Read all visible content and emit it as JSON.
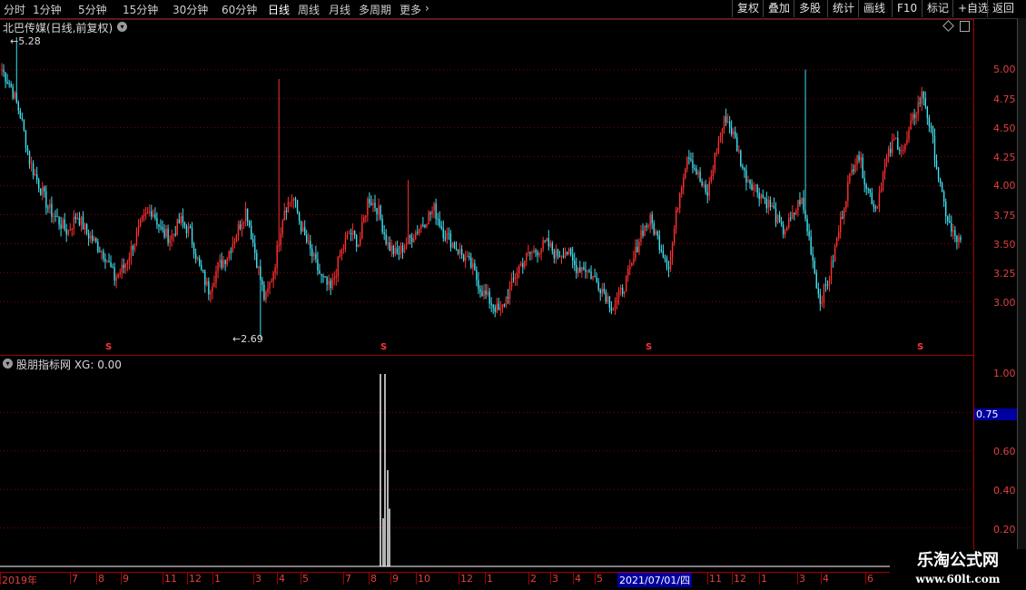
{
  "toolbar": {
    "timeframes": [
      "分时",
      "1分钟",
      "5分钟",
      "15分钟",
      "30分钟",
      "60分钟",
      "日线",
      "周线",
      "月线",
      "多周期",
      "更多"
    ],
    "active": "日线",
    "right_buttons": [
      "复权",
      "叠加",
      "多股",
      "统计",
      "画线",
      "F10",
      "标记",
      "+自选",
      "返回"
    ]
  },
  "main": {
    "title": "北巴传媒(日线,前复权)",
    "high_label": "5.28",
    "low_label": "2.69",
    "price_ticks": [
      "5.00",
      "4.75",
      "4.50",
      "4.25",
      "4.00",
      "3.75",
      "3.50",
      "3.25",
      "3.00"
    ],
    "signal_mark": "S"
  },
  "indicator": {
    "title": "股朋指标网 XG: 0.00",
    "ticks": [
      "1.00",
      "0.60",
      "0.40",
      "0.20"
    ],
    "highlight": "0.75"
  },
  "date_axis": {
    "labels": [
      "2019年",
      "7",
      "8",
      "9",
      "11",
      "12",
      "1",
      "3",
      "4",
      "5",
      "7",
      "8",
      "9",
      "10",
      "12",
      "1",
      "2",
      "3",
      "4",
      "5",
      "11",
      "12",
      "1",
      "3",
      "4",
      "6"
    ],
    "highlight": "2021/07/01/四"
  },
  "watermark": {
    "line1": "乐淘公式网",
    "line2": "www.60lt.com"
  },
  "colors": {
    "up": "#ff3030",
    "down": "#40e0f0",
    "axis": "#c00000",
    "grid": "#8b0000"
  },
  "chart_data": {
    "type": "candlestick",
    "ylim": [
      2.69,
      5.28
    ],
    "close_path": [
      5.0,
      4.85,
      4.6,
      4.2,
      4.0,
      3.8,
      3.7,
      3.6,
      3.75,
      3.6,
      3.5,
      3.4,
      3.2,
      3.3,
      3.5,
      3.7,
      3.8,
      3.6,
      3.55,
      3.7,
      3.6,
      3.3,
      3.1,
      3.3,
      3.4,
      3.6,
      3.8,
      3.4,
      3.0,
      3.3,
      3.8,
      3.9,
      3.6,
      3.4,
      3.2,
      3.1,
      3.4,
      3.6,
      3.5,
      3.9,
      3.8,
      3.5,
      3.4,
      3.5,
      3.6,
      3.7,
      3.8,
      3.6,
      3.5,
      3.4,
      3.3,
      3.1,
      3.0,
      2.9,
      3.1,
      3.3,
      3.4,
      3.45,
      3.5,
      3.4,
      3.45,
      3.3,
      3.3,
      3.2,
      3.1,
      2.95,
      3.1,
      3.3,
      3.6,
      3.7,
      3.5,
      3.3,
      3.9,
      4.3,
      4.1,
      3.9,
      4.3,
      4.6,
      4.4,
      4.1,
      4.0,
      3.9,
      3.8,
      3.6,
      3.7,
      3.9,
      3.5,
      3.0,
      3.2,
      3.6,
      4.0,
      4.3,
      4.0,
      3.8,
      4.2,
      4.4,
      4.3,
      4.6,
      4.8,
      4.4,
      3.9,
      3.6,
      3.5
    ]
  }
}
